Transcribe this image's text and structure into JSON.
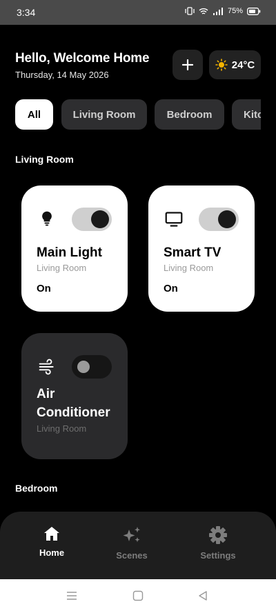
{
  "status_bar": {
    "time": "3:34",
    "battery": "75%"
  },
  "header": {
    "title": "Hello, Welcome Home",
    "date": "Thursday, 14 May 2026",
    "add_label": "+",
    "temperature": "24°C"
  },
  "tabs": [
    {
      "label": "All",
      "active": true
    },
    {
      "label": "Living Room",
      "active": false
    },
    {
      "label": "Bedroom",
      "active": false
    },
    {
      "label": "Kitc",
      "active": false
    }
  ],
  "sections": [
    {
      "title": "Living Room"
    },
    {
      "title": "Bedroom"
    }
  ],
  "devices": [
    {
      "name": "Main Light",
      "room": "Living Room",
      "state": "On",
      "on": true,
      "icon": "bulb-icon"
    },
    {
      "name": "Smart TV",
      "room": "Living Room",
      "state": "On",
      "on": true,
      "icon": "tv-icon"
    },
    {
      "name_line1": "Air",
      "name_line2": "Conditioner",
      "room": "Living Room",
      "on": false,
      "icon": "wind-icon"
    }
  ],
  "bottom_nav": [
    {
      "label": "Home",
      "icon": "home-icon",
      "active": true
    },
    {
      "label": "Scenes",
      "icon": "sparkles-icon",
      "active": false
    },
    {
      "label": "Settings",
      "icon": "gear-icon",
      "active": false
    }
  ],
  "colors": {
    "background": "#000000",
    "card_on": "#ffffff",
    "card_off": "#2a2a2c",
    "chip": "#2e2e30",
    "sun": "#f5b400"
  }
}
